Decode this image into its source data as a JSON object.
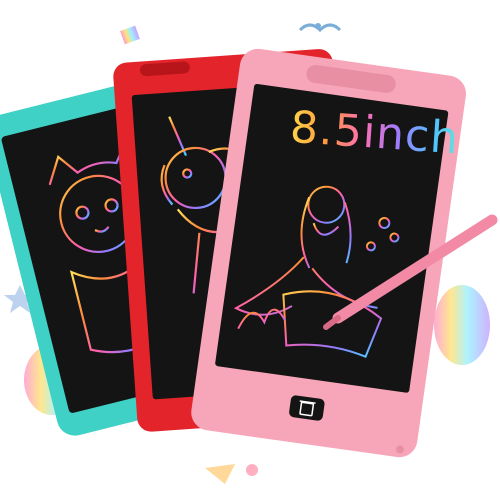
{
  "product": {
    "size_label": "8.5inch",
    "tablets": [
      {
        "name": "teal-tablet",
        "frame_color": "#3fd0c6",
        "drawing": "cat"
      },
      {
        "name": "red-tablet",
        "frame_color": "#e3242b",
        "drawing": "unicorn"
      },
      {
        "name": "pink-tablet",
        "frame_color": "#f7a6b9",
        "drawing": "mermaid"
      }
    ],
    "stylus_color": "#f28aa6",
    "erase_icon": "trash-icon",
    "screen_color": "#1a1a1a"
  }
}
